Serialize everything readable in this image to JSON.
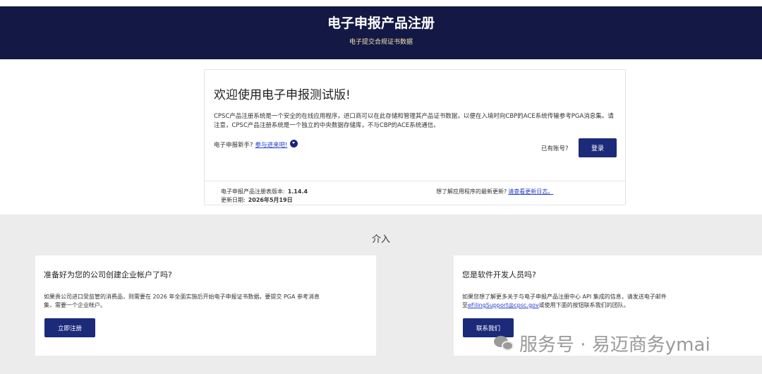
{
  "header": {
    "title": "电子申报产品注册",
    "subtitle": "电子提交合规证书数据"
  },
  "welcome": {
    "title": "欢迎使用电子申报测试版!",
    "description": "CPSC产品注册系统是一个安全的在线应用程序，进口商可以在此存储和管理其产品证书数据，以便在入境时向CBP的ACE系统传输参考PGA消息集。请注意，CPSC产品注册系统是一个独立的中央数据存储库，不与CBP的ACE系统通信。",
    "newcomer_text": "电子申报新手?",
    "newcomer_link": "参与进来吧!",
    "have_account": "已有账号?",
    "login_label": "登录",
    "version_label": "电子申报产品注册表版本:",
    "version_value": "1.14.4",
    "date_label": "更新日期:",
    "date_value": "2026年5月19日",
    "changelog_text": "想了解应用程序的最新更新?",
    "changelog_link": "请查看更新日志。"
  },
  "involve": {
    "title": "介入",
    "left": {
      "title": "准备好为您的公司创建企业帐户了吗?",
      "desc_line1": "如果贵公司进口受监管的消费品，则需要在 2026 年全面实施后开始电子申报证书数据。要提交 PGA 参考消息",
      "desc_line2": "集，需要一个企业帐户。",
      "button": "立即注册"
    },
    "right": {
      "title": "您是软件开发人员吗?",
      "desc_line1": "如果您想了解更多关于与电子申报产品注册中心 API 集成的信息，请发送电子邮件",
      "desc_prefix": "至",
      "email": "eFilingSupport@cpsc.gov",
      "desc_suffix": "或使用下面的按钮联系我们的团队。",
      "button": "联系我们"
    }
  },
  "watermark": {
    "text": "服务号 · 易迈商务ymai"
  },
  "colors": {
    "banner": "#141845",
    "button": "#1c2a7a",
    "link": "#2540c8",
    "section_bg": "#ececec"
  }
}
